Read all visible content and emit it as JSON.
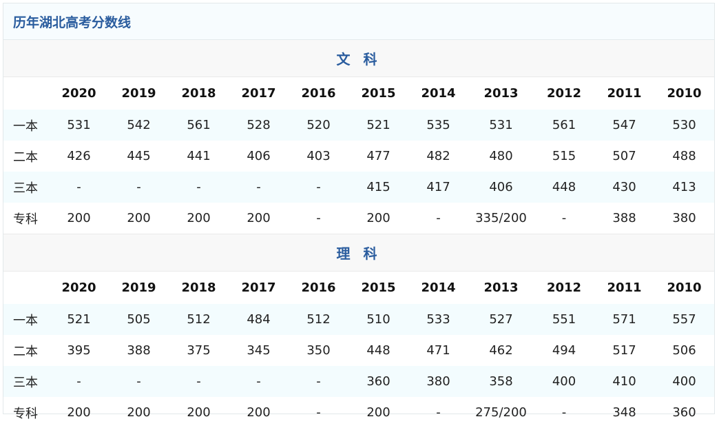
{
  "title": "历年湖北高考分数线",
  "years": [
    "2020",
    "2019",
    "2018",
    "2017",
    "2016",
    "2015",
    "2014",
    "2013",
    "2012",
    "2011",
    "2010"
  ],
  "sections": [
    {
      "name": "文 科",
      "rows": [
        {
          "label": "一本",
          "values": [
            "531",
            "542",
            "561",
            "528",
            "520",
            "521",
            "535",
            "531",
            "561",
            "547",
            "530"
          ]
        },
        {
          "label": "二本",
          "values": [
            "426",
            "445",
            "441",
            "406",
            "403",
            "477",
            "482",
            "480",
            "515",
            "507",
            "488"
          ]
        },
        {
          "label": "三本",
          "values": [
            "-",
            "-",
            "-",
            "-",
            "-",
            "415",
            "417",
            "406",
            "448",
            "430",
            "413"
          ]
        },
        {
          "label": "专科",
          "values": [
            "200",
            "200",
            "200",
            "200",
            "-",
            "200",
            "-",
            "335/200",
            "-",
            "388",
            "380"
          ]
        }
      ]
    },
    {
      "name": "理 科",
      "rows": [
        {
          "label": "一本",
          "values": [
            "521",
            "505",
            "512",
            "484",
            "512",
            "510",
            "533",
            "527",
            "551",
            "571",
            "557"
          ]
        },
        {
          "label": "二本",
          "values": [
            "395",
            "388",
            "375",
            "345",
            "350",
            "448",
            "471",
            "462",
            "494",
            "517",
            "506"
          ]
        },
        {
          "label": "三本",
          "values": [
            "-",
            "-",
            "-",
            "-",
            "-",
            "360",
            "380",
            "358",
            "400",
            "410",
            "400"
          ]
        },
        {
          "label": "专科",
          "values": [
            "200",
            "200",
            "200",
            "200",
            "-",
            "200",
            "-",
            "275/200",
            "-",
            "348",
            "360"
          ]
        }
      ]
    }
  ]
}
